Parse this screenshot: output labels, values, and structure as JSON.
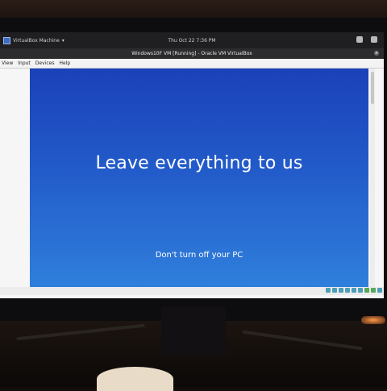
{
  "host_topbar": {
    "app_menu_label": "VirtualBox Machine",
    "datetime": "Thu Oct 22  7:36 PM"
  },
  "window": {
    "title": "Windows10F VM [Running] - Oracle VM VirtualBox"
  },
  "menubar": {
    "items": [
      "View",
      "Input",
      "Devices",
      "Help"
    ]
  },
  "guest_screen": {
    "headline": "Leave everything to us",
    "subtext": "Don't turn off your PC",
    "background_color_top": "#1b41b9",
    "background_color_bottom": "#2f7fdc"
  },
  "statusbar": {
    "icons": [
      "hard-disk-icon",
      "optical-drive-icon",
      "usb-icon",
      "shared-folders-icon",
      "display-icon",
      "video-capture-icon",
      "network-icon",
      "mouse-integration-icon",
      "host-key-icon"
    ]
  }
}
